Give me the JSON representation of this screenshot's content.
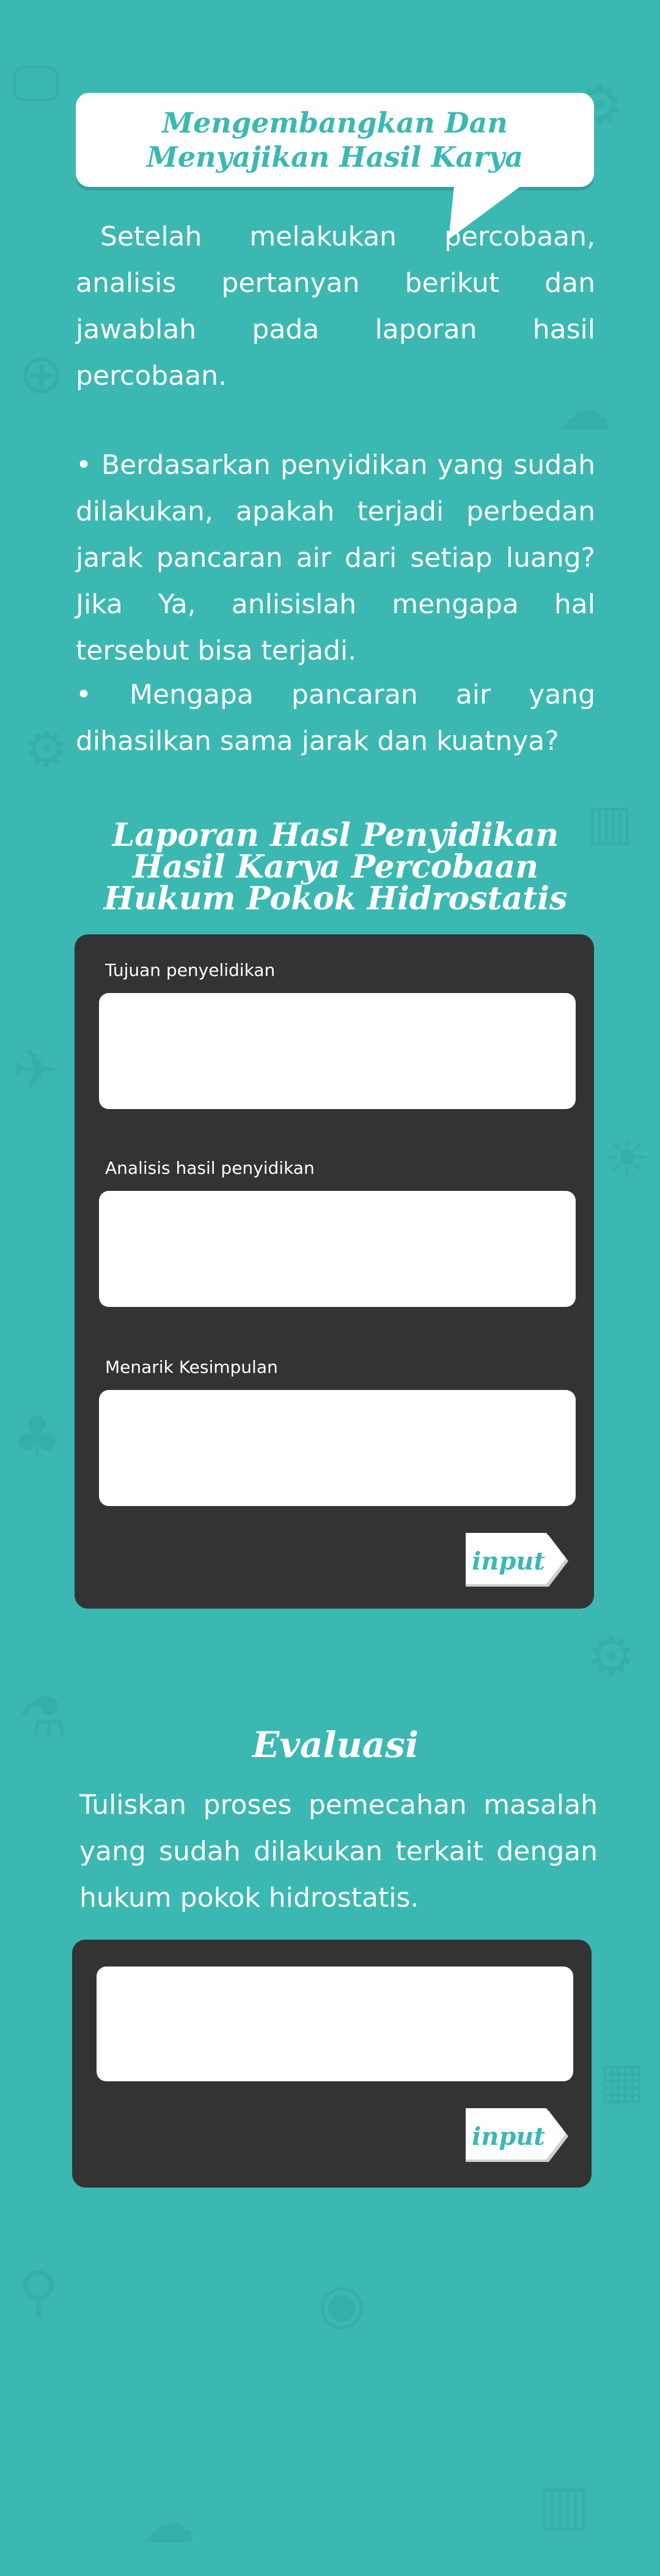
{
  "header": {
    "title": "Mengembangkan Dan Menyajikan Hasil  Karya"
  },
  "intro": {
    "text": "Setelah melakukan percobaan, analisis pertanyan berikut dan jawablah pada laporan hasil percobaan."
  },
  "questions": [
    "• Berdasarkan penyidikan yang sudah dilakukan, apakah terjadi perbedan jarak pancaran air dari setiap luang? Jika Ya, anlisislah mengapa hal tersebut bisa terjadi.",
    "• Mengapa pancaran air yang dihasilkan sama jarak dan kuatnya?"
  ],
  "laporan": {
    "title_line1": "Laporan Hasl Penyidikan",
    "title_line2": "Hasil Karya  Percobaan",
    "title_line3": "Hukum Pokok Hidrostatis",
    "fields": [
      {
        "label": "Tujuan penyelidikan",
        "value": ""
      },
      {
        "label": "Analisis hasil penyidikan",
        "value": ""
      },
      {
        "label": "Menarik Kesimpulan",
        "value": ""
      }
    ],
    "button_label": "input"
  },
  "evaluasi": {
    "title": "Evaluasi",
    "text": "Tuliskan proses pemecahan masalah yang sudah dilakukan terkait dengan hukum pokok hidrostatis.",
    "field_value": "",
    "button_label": "input"
  },
  "colors": {
    "background": "#3bb8b2",
    "panel": "#333333",
    "accent": "#3bb8b2",
    "text_light": "#ffffff"
  },
  "icons": {
    "background_pattern": [
      "monitor-icon",
      "rocket-icon",
      "gear-icon",
      "compass-icon",
      "cloud-icon",
      "chart-icon",
      "satellite-icon",
      "tree-icon",
      "flask-icon",
      "bulb-icon",
      "calendar-icon",
      "camera-icon"
    ]
  }
}
